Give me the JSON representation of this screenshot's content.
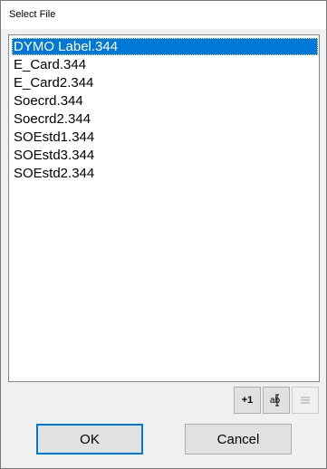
{
  "window": {
    "title": "Select File"
  },
  "files": [
    {
      "name": "DYMO Label.344",
      "selected": true
    },
    {
      "name": "E_Card.344",
      "selected": false
    },
    {
      "name": "E_Card2.344",
      "selected": false
    },
    {
      "name": "Soecrd.344",
      "selected": false
    },
    {
      "name": "Soecrd2.344",
      "selected": false
    },
    {
      "name": "SOEstd1.344",
      "selected": false
    },
    {
      "name": "SOEstd3.344",
      "selected": false
    },
    {
      "name": "SOEstd2.344",
      "selected": false
    }
  ],
  "toolbar": {
    "increment_label": "+1",
    "edit_icon": "abc-edit-icon",
    "list_icon": "list-icon"
  },
  "buttons": {
    "ok": "OK",
    "cancel": "Cancel"
  },
  "colors": {
    "selection": "#0078d7",
    "default_button_border": "#0078d7"
  }
}
